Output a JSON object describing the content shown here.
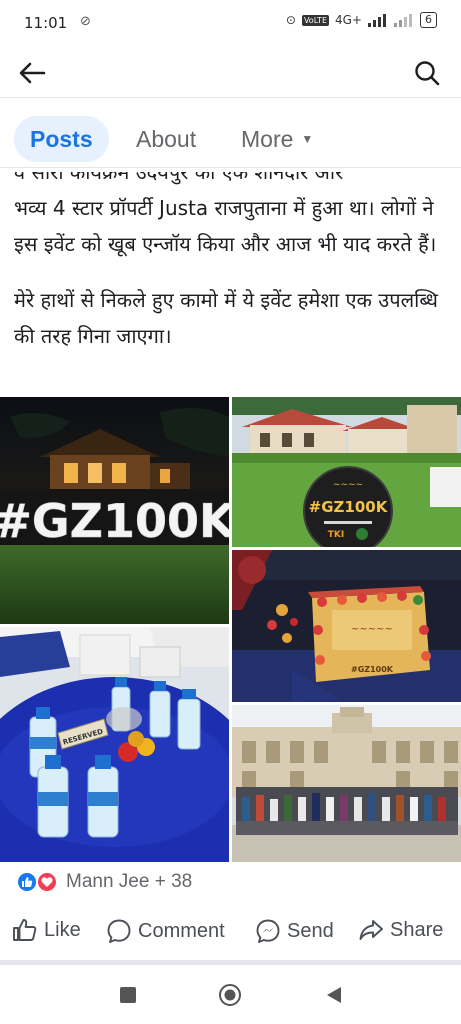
{
  "status_bar": {
    "time": "11:01",
    "signal": "4G+",
    "battery": "6"
  },
  "icons": {
    "back": "arrow-left-icon",
    "search": "search-icon",
    "more_caret": "caret-down-icon",
    "like": "thumbs-up-icon",
    "comment": "comment-bubble-icon",
    "send": "messenger-send-icon",
    "share": "share-arrow-icon"
  },
  "tabs": {
    "posts": "Posts",
    "about": "About",
    "more": "More"
  },
  "post": {
    "line_clipped": "व सारा कार्यक्रम उदयपुर की एक शानदार और",
    "para1": "भव्य 4 स्टार प्रॉपर्टी Justa राजपुताना में हुआ था। लोगों ने इस इवेंट को खूब एन्जॉय किया और आज भी याद करते हैं।",
    "para2": "मेरे हाथों से निकले हुए कामो में ये इवेंट हमेशा एक उपलब्धि की तरह गिना जाएगा।",
    "photos": {
      "sign_text": "#GZ100K",
      "badge_text": "#GZ100K",
      "badge_sub": "TKI",
      "cake_text": "#GZ100K",
      "reserved_text": "RESERVED"
    }
  },
  "reactions": {
    "text": "Mann Jee + 38"
  },
  "actions": {
    "like": "Like",
    "comment": "Comment",
    "send": "Send",
    "share": "Share"
  },
  "colors": {
    "accent": "#1b74e4",
    "tab_active_bg": "#e7f0fd",
    "like_blue": "#1877f2",
    "love_red": "#f33e58",
    "text_muted": "#65676b"
  }
}
